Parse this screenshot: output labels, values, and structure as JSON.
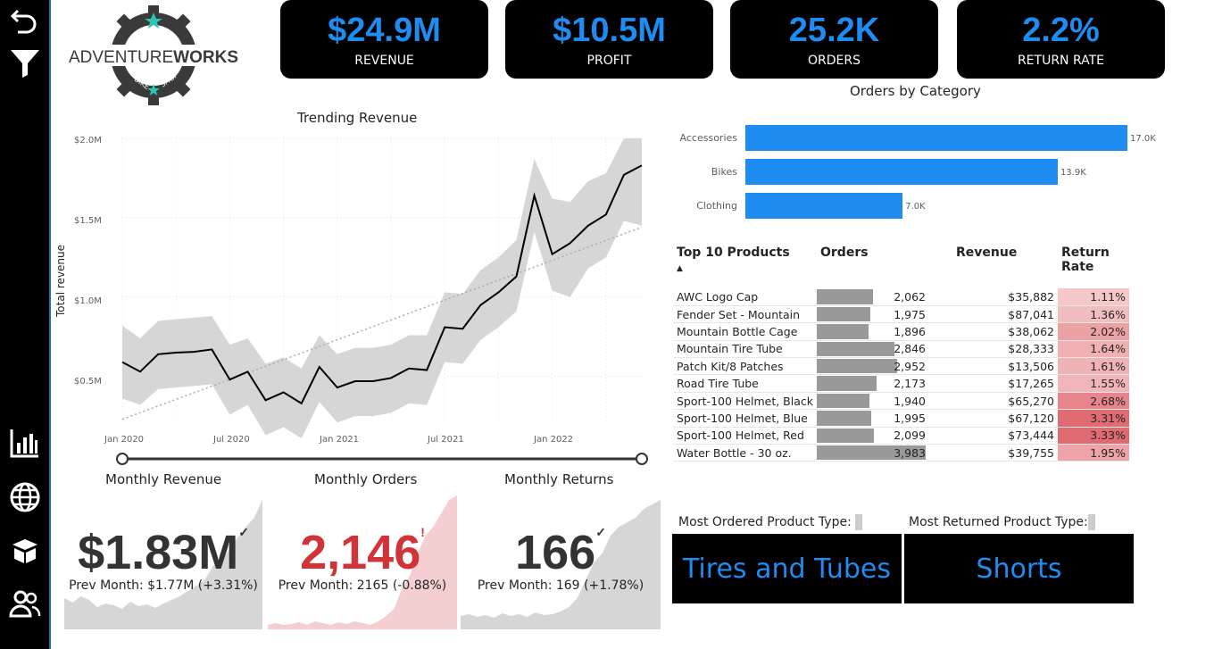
{
  "brand": {
    "name_left": "ADVENTURE",
    "name_right": "WORKS",
    "sub_left": "BIKE",
    "sub_right": "SHOP"
  },
  "kpis": [
    {
      "value": "$24.9M",
      "label": "REVENUE"
    },
    {
      "value": "$10.5M",
      "label": "PROFIT"
    },
    {
      "value": "25.2K",
      "label": "ORDERS"
    },
    {
      "value": "2.2%",
      "label": "RETURN RATE"
    }
  ],
  "trend": {
    "title": "Trending Revenue",
    "ylabel": "Total revenue",
    "yticks": [
      "$2.0M",
      "$1.5M",
      "$1.0M",
      "$0.5M"
    ],
    "xticks": [
      "Jan 2020",
      "Jul 2020",
      "Jan 2021",
      "Jul 2021",
      "Jan 2022"
    ]
  },
  "chart_data": [
    {
      "type": "line",
      "title": "Trending Revenue",
      "ylabel": "Total revenue",
      "ylim": [
        0.2,
        2.0
      ],
      "x": [
        "2020-01",
        "2020-02",
        "2020-03",
        "2020-04",
        "2020-05",
        "2020-06",
        "2020-07",
        "2020-08",
        "2020-09",
        "2020-10",
        "2020-11",
        "2020-12",
        "2021-01",
        "2021-02",
        "2021-03",
        "2021-04",
        "2021-05",
        "2021-06",
        "2021-07",
        "2021-08",
        "2021-09",
        "2021-10",
        "2021-11",
        "2021-12",
        "2022-01",
        "2022-02",
        "2022-03",
        "2022-04",
        "2022-05",
        "2022-06"
      ],
      "series": [
        {
          "name": "revenue",
          "values": [
            0.59,
            0.53,
            0.64,
            0.65,
            0.655,
            0.67,
            0.48,
            0.53,
            0.35,
            0.4,
            0.33,
            0.56,
            0.43,
            0.47,
            0.47,
            0.49,
            0.55,
            0.54,
            0.81,
            0.8,
            0.95,
            1.03,
            1.13,
            1.64,
            1.27,
            1.34,
            1.45,
            1.52,
            1.77,
            1.83
          ]
        },
        {
          "name": "upper",
          "values": [
            0.82,
            0.74,
            0.85,
            0.86,
            0.87,
            0.88,
            0.7,
            0.74,
            0.58,
            0.62,
            0.55,
            0.76,
            0.64,
            0.68,
            0.68,
            0.7,
            0.76,
            0.76,
            1.03,
            1.02,
            1.17,
            1.25,
            1.36,
            1.87,
            1.62,
            1.6,
            1.73,
            1.78,
            2.0,
            2.0
          ]
        },
        {
          "name": "lower",
          "values": [
            0.36,
            0.32,
            0.42,
            0.43,
            0.44,
            0.45,
            0.26,
            0.32,
            0.13,
            0.18,
            0.11,
            0.34,
            0.21,
            0.25,
            0.25,
            0.27,
            0.33,
            0.32,
            0.59,
            0.58,
            0.73,
            0.81,
            0.91,
            1.41,
            1.04,
            1.0,
            1.18,
            1.25,
            1.48,
            1.45
          ]
        },
        {
          "name": "trend",
          "values": [
            0.23,
            1.44
          ]
        }
      ]
    },
    {
      "type": "bar",
      "title": "Orders by Category",
      "categories": [
        "Accessories",
        "Bikes",
        "Clothing"
      ],
      "values": [
        17.0,
        13.9,
        7.0
      ],
      "labels": [
        "17.0K",
        "13.9K",
        "7.0K"
      ],
      "xlim": [
        0,
        17.0
      ]
    }
  ],
  "categories_title": "Orders by Category",
  "table": {
    "headers": [
      "Top 10 Products",
      "Orders",
      "Revenue",
      "Return Rate"
    ],
    "header_rr_1": "Return",
    "header_rr_2": "Rate",
    "rows": [
      {
        "product": "AWC Logo Cap",
        "orders": "2,062",
        "orders_num": 2062,
        "revenue": "$35,882",
        "rr": "1.11%",
        "rr_num": 1.11
      },
      {
        "product": "Fender Set - Mountain",
        "orders": "1,975",
        "orders_num": 1975,
        "revenue": "$87,041",
        "rr": "1.36%",
        "rr_num": 1.36
      },
      {
        "product": "Mountain Bottle Cage",
        "orders": "1,896",
        "orders_num": 1896,
        "revenue": "$38,062",
        "rr": "2.02%",
        "rr_num": 2.02
      },
      {
        "product": "Mountain Tire Tube",
        "orders": "2,846",
        "orders_num": 2846,
        "revenue": "$28,333",
        "rr": "1.64%",
        "rr_num": 1.64
      },
      {
        "product": "Patch Kit/8 Patches",
        "orders": "2,952",
        "orders_num": 2952,
        "revenue": "$13,506",
        "rr": "1.61%",
        "rr_num": 1.61
      },
      {
        "product": "Road Tire Tube",
        "orders": "2,173",
        "orders_num": 2173,
        "revenue": "$17,265",
        "rr": "1.55%",
        "rr_num": 1.55
      },
      {
        "product": "Sport-100 Helmet, Black",
        "orders": "1,940",
        "orders_num": 1940,
        "revenue": "$65,270",
        "rr": "2.68%",
        "rr_num": 2.68
      },
      {
        "product": "Sport-100 Helmet, Blue",
        "orders": "1,995",
        "orders_num": 1995,
        "revenue": "$67,120",
        "rr": "3.31%",
        "rr_num": 3.31
      },
      {
        "product": "Sport-100 Helmet, Red",
        "orders": "2,099",
        "orders_num": 2099,
        "revenue": "$73,444",
        "rr": "3.33%",
        "rr_num": 3.33
      },
      {
        "product": "Water Bottle - 30 oz.",
        "orders": "3,983",
        "orders_num": 3983,
        "revenue": "$39,755",
        "rr": "1.95%",
        "rr_num": 1.95
      }
    ]
  },
  "cards": [
    {
      "title": "Monthly Revenue",
      "value": "$1.83M",
      "sub": "Prev Month: $1.77M (+3.31%)",
      "color": "#333333",
      "mark": "✓"
    },
    {
      "title": "Monthly Orders",
      "value": "2,146",
      "sub": "Prev Month: 2165 (-0.88%)",
      "color": "#d13438",
      "mark": "!"
    },
    {
      "title": "Monthly Returns",
      "value": "166",
      "sub": "Prev Month: 169 (+1.78%)",
      "color": "#333333",
      "mark": "✓"
    }
  ],
  "product_types": {
    "most_ordered_label": "Most Ordered Product Type:",
    "most_ordered_value": "Tires and Tubes",
    "most_returned_label": "Most Returned Product Type:",
    "most_returned_value": "Shorts"
  },
  "colors": {
    "accent": "#1e8cf0",
    "alert": "#d13438",
    "rr_low": "#f4c7c9",
    "rr_high": "#e06a72"
  }
}
